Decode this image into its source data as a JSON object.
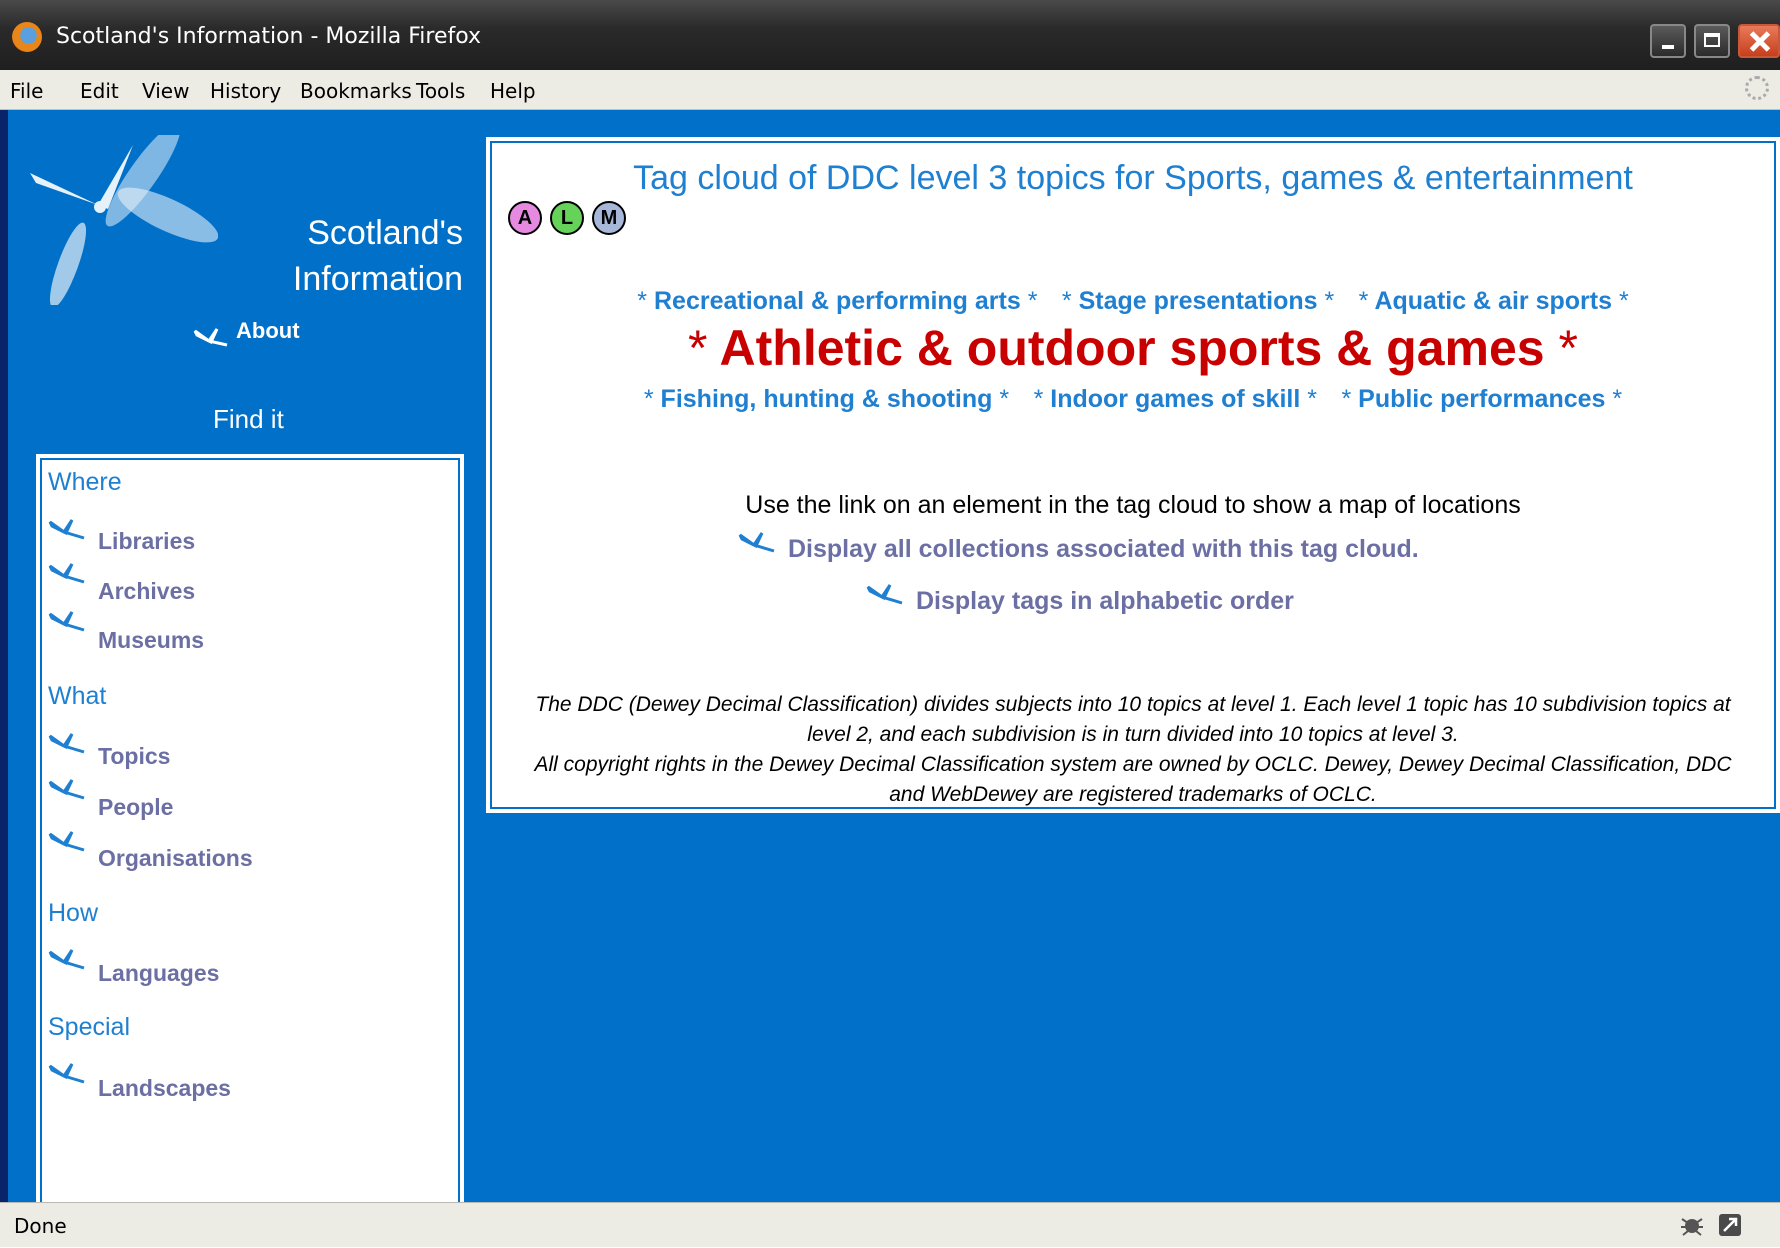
{
  "window": {
    "title": "Scotland's Information - Mozilla Firefox"
  },
  "menu": [
    "File",
    "Edit",
    "View",
    "History",
    "Bookmarks",
    "Tools",
    "Help"
  ],
  "site": {
    "title_line1": "Scotland's",
    "title_line2": "Information",
    "about": "About",
    "find_it": "Find it"
  },
  "nav": {
    "where": "Where",
    "what": "What",
    "how": "How",
    "special": "Special",
    "libraries": "Libraries",
    "archives": "Archives",
    "museums": "Museums",
    "topics": "Topics",
    "people": "People",
    "organisations": "Organisations",
    "languages": "Languages",
    "landscapes": "Landscapes"
  },
  "main": {
    "title": "Tag cloud of DDC level 3 topics for Sports, games & entertainment",
    "badges": [
      "A",
      "L",
      "M"
    ],
    "star": "*",
    "tags_row1": [
      "Recreational & performing arts",
      "Stage presentations",
      "Aquatic & air sports"
    ],
    "tag_big": "Athletic & outdoor sports & games",
    "tags_row3": [
      "Fishing, hunting & shooting",
      "Indoor games of skill",
      "Public performances"
    ],
    "hint": "Use the link on an element in the tag cloud to show a map of locations",
    "display_all": "Display all collections associated with this tag cloud.",
    "display_alpha": "Display tags in alphabetic order",
    "ddc_note_1": "The DDC (Dewey Decimal Classification) divides subjects into 10 topics at level 1. Each level 1 topic has 10 subdivision topics at level 2, and each subdivision is in turn divided into 10 topics at level 3.",
    "ddc_note_2": "All copyright rights in the Dewey Decimal Classification system are owned by OCLC. Dewey, Dewey Decimal Classification, DDC and WebDewey are registered trademarks of OCLC."
  },
  "status": {
    "text": "Done"
  },
  "colors": {
    "page_bg": "#0070c8",
    "link": "#1f7fd0",
    "visited_link": "#6c6fa3",
    "big_tag": "#c80000"
  }
}
